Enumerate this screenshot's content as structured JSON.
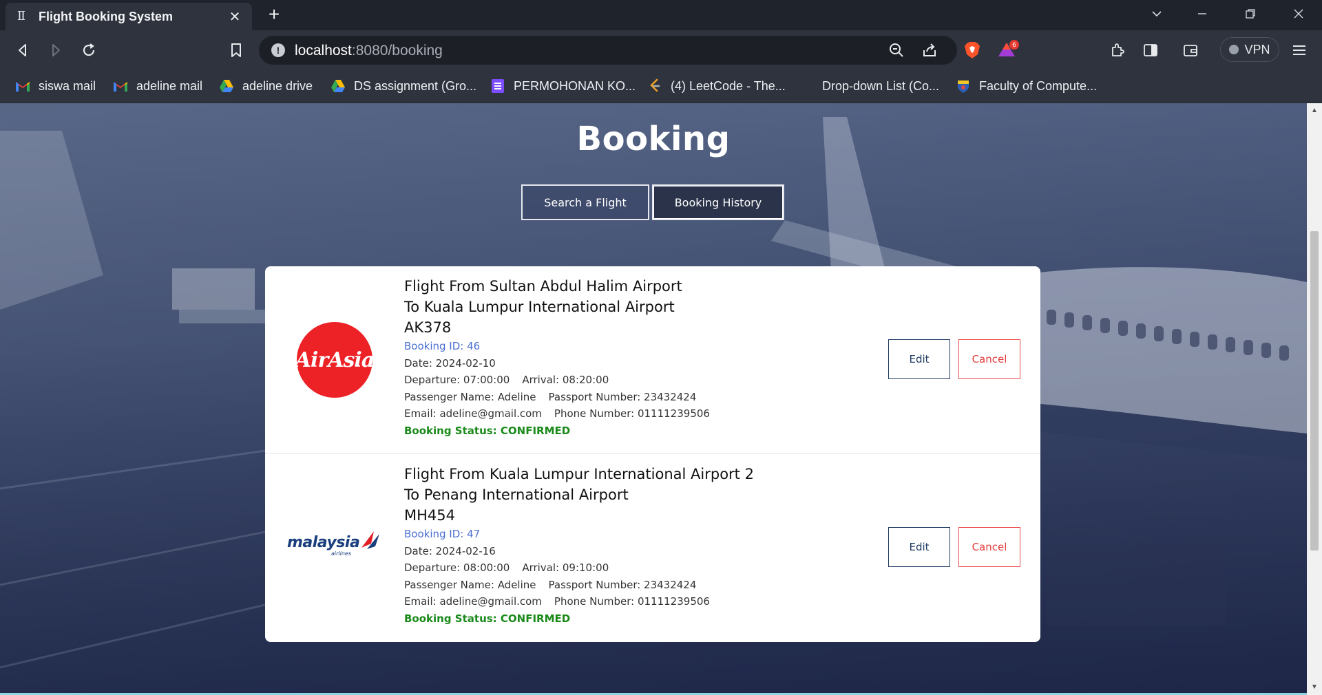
{
  "browser": {
    "tab_title": "Flight Booking System",
    "tab_close": "✕",
    "new_tab": "+",
    "url_host": "localhost",
    "url_path": ":8080/booking",
    "vpn_label": "VPN",
    "brave_badge": "6",
    "bookmarks": [
      {
        "label": "siswa mail",
        "icon": "gmail-icon"
      },
      {
        "label": "adeline mail",
        "icon": "gmail-icon"
      },
      {
        "label": "adeline drive",
        "icon": "google-drive-icon"
      },
      {
        "label": "DS assignment (Gro...",
        "icon": "google-drive-icon"
      },
      {
        "label": "PERMOHONAN KO...",
        "icon": "google-forms-icon"
      },
      {
        "label": "(4) LeetCode - The...",
        "icon": "leetcode-icon"
      },
      {
        "label": "Drop-down List (Co...",
        "icon": "none"
      },
      {
        "label": "Faculty of Compute...",
        "icon": "faculty-crest-icon"
      }
    ],
    "colors": {
      "chrome_dark": "#1f232b",
      "chrome": "#2e333d",
      "omnibox": "#1c1f25"
    }
  },
  "page": {
    "title": "Booking",
    "nav": {
      "search_label": "Search a Flight",
      "history_label": "Booking History"
    },
    "bookings": [
      {
        "airline_logo": "airasia-logo",
        "airline_logo_text": "AirAsia",
        "route_from": "Flight From Sultan Abdul Halim Airport",
        "route_to": "To Kuala Lumpur International Airport",
        "flight_no": "AK378",
        "booking_id": "Booking ID: 46",
        "date": "Date: 2024-02-10",
        "departure": "Departure: 07:00:00",
        "arrival": "Arrival: 08:20:00",
        "passenger": "Passenger Name: Adeline",
        "passport": "Passport Number: 23432424",
        "email": "Email: adeline@gmail.com",
        "phone": "Phone Number: 01111239506",
        "status": "Booking Status: CONFIRMED",
        "edit_label": "Edit",
        "cancel_label": "Cancel"
      },
      {
        "airline_logo": "malaysia-airlines-logo",
        "airline_logo_text": "malaysia",
        "airline_logo_sub": "airlines",
        "route_from": "Flight From Kuala Lumpur International Airport 2",
        "route_to": "To Penang International Airport",
        "flight_no": "MH454",
        "booking_id": "Booking ID: 47",
        "date": "Date: 2024-02-16",
        "departure": "Departure: 08:00:00",
        "arrival": "Arrival: 09:10:00",
        "passenger": "Passenger Name: Adeline",
        "passport": "Passport Number: 23432424",
        "email": "Email: adeline@gmail.com",
        "phone": "Phone Number: 01111239506",
        "status": "Booking Status: CONFIRMED",
        "edit_label": "Edit",
        "cancel_label": "Cancel"
      }
    ],
    "colors": {
      "status_green": "#1a8a1a",
      "booking_id_blue": "#4a6fd1",
      "cancel_red": "#e23c3c",
      "edit_navy": "#1d3a62",
      "airasia_red": "#ec2227",
      "mas_navy": "#1b3f7e"
    }
  }
}
